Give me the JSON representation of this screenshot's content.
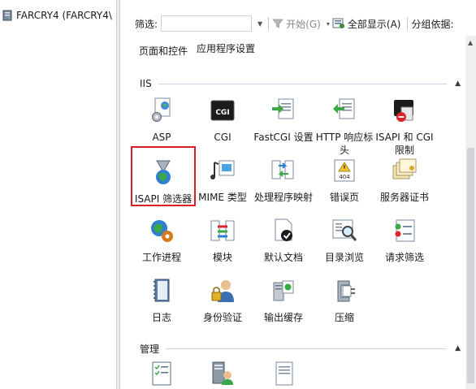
{
  "tree": {
    "server_label": "FARCRY4 (FARCRY4\\"
  },
  "toolbar": {
    "filter_label": "筛选:",
    "start_label": "开始(G)",
    "show_all_label": "全部显示(A)",
    "group_by_label": "分组依据:"
  },
  "top_items": {
    "page_controls": "页面和控件",
    "app_settings": "应用程序设置"
  },
  "groups": {
    "iis": "IIS",
    "management": "管理"
  },
  "items": {
    "asp": "ASP",
    "cgi": "CGI",
    "fastcgi": "FastCGI 设置",
    "http_headers": "HTTP 响应标头",
    "isapi_cgi": "ISAPI 和 CGI 限制",
    "isapi_filters": "ISAPI 筛选器",
    "mime": "MIME 类型",
    "handlers": "处理程序映射",
    "error_pages": "错误页",
    "server_certs": "服务器证书",
    "worker_processes": "工作进程",
    "modules": "模块",
    "default_doc": "默认文档",
    "dir_browse": "目录浏览",
    "request_filter": "请求筛选",
    "logging": "日志",
    "auth": "身份验证",
    "output_cache": "输出缓存",
    "compression": "压缩"
  },
  "icons": {
    "cgi_text": "CGI",
    "error_code": "404"
  },
  "colors": {
    "selection_border": "#d9202a",
    "group_line": "#c9d6e6"
  }
}
